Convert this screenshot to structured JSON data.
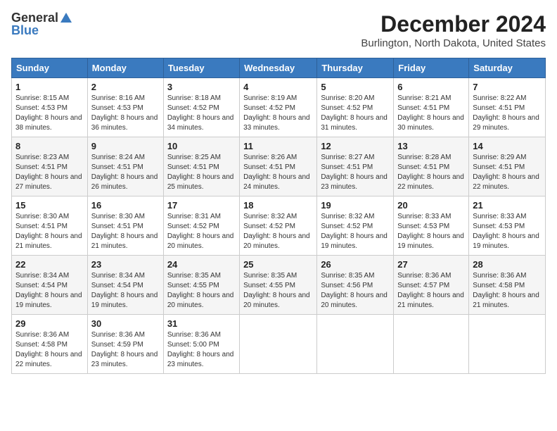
{
  "logo": {
    "general": "General",
    "blue": "Blue"
  },
  "title": "December 2024",
  "location": "Burlington, North Dakota, United States",
  "days_header": [
    "Sunday",
    "Monday",
    "Tuesday",
    "Wednesday",
    "Thursday",
    "Friday",
    "Saturday"
  ],
  "weeks": [
    [
      {
        "day": "1",
        "sunrise": "8:15 AM",
        "sunset": "4:53 PM",
        "daylight": "8 hours and 38 minutes."
      },
      {
        "day": "2",
        "sunrise": "8:16 AM",
        "sunset": "4:53 PM",
        "daylight": "8 hours and 36 minutes."
      },
      {
        "day": "3",
        "sunrise": "8:18 AM",
        "sunset": "4:52 PM",
        "daylight": "8 hours and 34 minutes."
      },
      {
        "day": "4",
        "sunrise": "8:19 AM",
        "sunset": "4:52 PM",
        "daylight": "8 hours and 33 minutes."
      },
      {
        "day": "5",
        "sunrise": "8:20 AM",
        "sunset": "4:52 PM",
        "daylight": "8 hours and 31 minutes."
      },
      {
        "day": "6",
        "sunrise": "8:21 AM",
        "sunset": "4:51 PM",
        "daylight": "8 hours and 30 minutes."
      },
      {
        "day": "7",
        "sunrise": "8:22 AM",
        "sunset": "4:51 PM",
        "daylight": "8 hours and 29 minutes."
      }
    ],
    [
      {
        "day": "8",
        "sunrise": "8:23 AM",
        "sunset": "4:51 PM",
        "daylight": "8 hours and 27 minutes."
      },
      {
        "day": "9",
        "sunrise": "8:24 AM",
        "sunset": "4:51 PM",
        "daylight": "8 hours and 26 minutes."
      },
      {
        "day": "10",
        "sunrise": "8:25 AM",
        "sunset": "4:51 PM",
        "daylight": "8 hours and 25 minutes."
      },
      {
        "day": "11",
        "sunrise": "8:26 AM",
        "sunset": "4:51 PM",
        "daylight": "8 hours and 24 minutes."
      },
      {
        "day": "12",
        "sunrise": "8:27 AM",
        "sunset": "4:51 PM",
        "daylight": "8 hours and 23 minutes."
      },
      {
        "day": "13",
        "sunrise": "8:28 AM",
        "sunset": "4:51 PM",
        "daylight": "8 hours and 22 minutes."
      },
      {
        "day": "14",
        "sunrise": "8:29 AM",
        "sunset": "4:51 PM",
        "daylight": "8 hours and 22 minutes."
      }
    ],
    [
      {
        "day": "15",
        "sunrise": "8:30 AM",
        "sunset": "4:51 PM",
        "daylight": "8 hours and 21 minutes."
      },
      {
        "day": "16",
        "sunrise": "8:30 AM",
        "sunset": "4:51 PM",
        "daylight": "8 hours and 21 minutes."
      },
      {
        "day": "17",
        "sunrise": "8:31 AM",
        "sunset": "4:52 PM",
        "daylight": "8 hours and 20 minutes."
      },
      {
        "day": "18",
        "sunrise": "8:32 AM",
        "sunset": "4:52 PM",
        "daylight": "8 hours and 20 minutes."
      },
      {
        "day": "19",
        "sunrise": "8:32 AM",
        "sunset": "4:52 PM",
        "daylight": "8 hours and 19 minutes."
      },
      {
        "day": "20",
        "sunrise": "8:33 AM",
        "sunset": "4:53 PM",
        "daylight": "8 hours and 19 minutes."
      },
      {
        "day": "21",
        "sunrise": "8:33 AM",
        "sunset": "4:53 PM",
        "daylight": "8 hours and 19 minutes."
      }
    ],
    [
      {
        "day": "22",
        "sunrise": "8:34 AM",
        "sunset": "4:54 PM",
        "daylight": "8 hours and 19 minutes."
      },
      {
        "day": "23",
        "sunrise": "8:34 AM",
        "sunset": "4:54 PM",
        "daylight": "8 hours and 19 minutes."
      },
      {
        "day": "24",
        "sunrise": "8:35 AM",
        "sunset": "4:55 PM",
        "daylight": "8 hours and 20 minutes."
      },
      {
        "day": "25",
        "sunrise": "8:35 AM",
        "sunset": "4:55 PM",
        "daylight": "8 hours and 20 minutes."
      },
      {
        "day": "26",
        "sunrise": "8:35 AM",
        "sunset": "4:56 PM",
        "daylight": "8 hours and 20 minutes."
      },
      {
        "day": "27",
        "sunrise": "8:36 AM",
        "sunset": "4:57 PM",
        "daylight": "8 hours and 21 minutes."
      },
      {
        "day": "28",
        "sunrise": "8:36 AM",
        "sunset": "4:58 PM",
        "daylight": "8 hours and 21 minutes."
      }
    ],
    [
      {
        "day": "29",
        "sunrise": "8:36 AM",
        "sunset": "4:58 PM",
        "daylight": "8 hours and 22 minutes."
      },
      {
        "day": "30",
        "sunrise": "8:36 AM",
        "sunset": "4:59 PM",
        "daylight": "8 hours and 23 minutes."
      },
      {
        "day": "31",
        "sunrise": "8:36 AM",
        "sunset": "5:00 PM",
        "daylight": "8 hours and 23 minutes."
      },
      null,
      null,
      null,
      null
    ]
  ]
}
